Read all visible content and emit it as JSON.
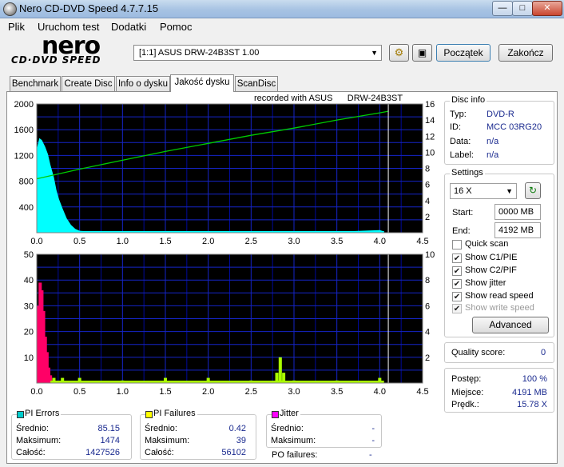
{
  "window": {
    "title": "Nero CD-DVD Speed 4.7.7.15"
  },
  "menu": [
    "Plik",
    "Uruchom test",
    "Dodatki",
    "Pomoc"
  ],
  "logo": {
    "main": "nero",
    "sub": "CD·DVD SPEED"
  },
  "toolbar": {
    "drive": "[1:1]   ASUS DRW-24B3ST 1.00",
    "start_label": "Początek",
    "end_label": "Zakończ"
  },
  "tabs": [
    "Benchmark",
    "Create Disc",
    "Info o dysku",
    "Jakość dysku",
    "ScanDisc"
  ],
  "active_tab": 3,
  "recorded_label": "recorded with ASUS      DRW-24B3ST",
  "chart_data": [
    {
      "type": "area",
      "title": "",
      "x_ticks": [
        "0.0",
        "0.5",
        "1.0",
        "1.5",
        "2.0",
        "2.5",
        "3.0",
        "3.5",
        "4.0",
        "4.5"
      ],
      "y_left_ticks": [
        "2000",
        "1600",
        "1200",
        "800",
        "400"
      ],
      "y_right_ticks": [
        "16",
        "14",
        "12",
        "10",
        "8",
        "6",
        "4",
        "2"
      ],
      "xlim": [
        0,
        4.5
      ],
      "ylim_left": [
        0,
        2000
      ],
      "ylim_right": [
        0,
        16
      ],
      "grid": true,
      "series": [
        {
          "x": [
            0.0,
            0.03,
            0.06,
            0.1,
            0.13,
            0.16,
            0.2,
            0.23,
            0.26,
            0.3,
            0.35,
            0.4,
            0.45,
            0.5,
            0.6,
            0.8,
            1.0,
            1.5,
            2.0,
            2.5,
            3.0,
            3.5,
            4.0,
            4.05
          ],
          "values": [
            1300,
            1470,
            1440,
            1330,
            1220,
            1050,
            860,
            660,
            520,
            380,
            220,
            120,
            60,
            30,
            20,
            15,
            15,
            14,
            14,
            15,
            15,
            16,
            40,
            20
          ]
        },
        {
          "x": [
            0,
            0.5,
            1.0,
            1.5,
            2.0,
            2.5,
            3.0,
            3.5,
            4.0,
            4.1
          ],
          "values": [
            6.7,
            7.9,
            9.0,
            10.1,
            11.1,
            12.1,
            13.0,
            14.0,
            14.9,
            15.1
          ],
          "axis": "right"
        }
      ],
      "colors": [
        "#00ffff",
        "#00cc00"
      ],
      "marker_x": 4.1
    },
    {
      "type": "bar",
      "title": "",
      "x_ticks": [
        "0.0",
        "0.5",
        "1.0",
        "1.5",
        "2.0",
        "2.5",
        "3.0",
        "3.5",
        "4.0",
        "4.5"
      ],
      "y_left_ticks": [
        "50",
        "40",
        "30",
        "20",
        "10"
      ],
      "y_right_ticks": [
        "10",
        "8",
        "6",
        "4",
        "2"
      ],
      "xlim": [
        0,
        4.5
      ],
      "ylim_left": [
        0,
        50
      ],
      "ylim_right": [
        0,
        10
      ],
      "grid": true,
      "series": [
        {
          "x": [
            0.02,
            0.04,
            0.06,
            0.08,
            0.1,
            0.12,
            0.14,
            0.16,
            0.2,
            0.3,
            0.5,
            1.0,
            1.5,
            2.0,
            2.5,
            2.8,
            2.84,
            2.88,
            3.0,
            3.5,
            4.0
          ],
          "values": [
            30,
            39,
            36,
            28,
            18,
            12,
            6,
            3,
            2,
            2,
            2,
            1,
            2,
            2,
            1,
            4,
            10,
            4,
            1,
            1,
            2
          ]
        }
      ],
      "colors": [
        "#ff0066",
        "#aaff00"
      ],
      "marker_x": 4.1
    }
  ],
  "disc_info": {
    "title": "Disc info",
    "rows": [
      {
        "label": "Typ:",
        "value": "DVD-R"
      },
      {
        "label": "ID:",
        "value": "MCC 03RG20"
      },
      {
        "label": "Data:",
        "value": "n/a"
      },
      {
        "label": "Label:",
        "value": "n/a"
      }
    ]
  },
  "settings": {
    "title": "Settings",
    "speed": "16 X",
    "start_label": "Start:",
    "start_value": "0000 MB",
    "end_label": "End:",
    "end_value": "4192 MB",
    "checks": [
      {
        "label": "Quick scan",
        "checked": false,
        "enabled": true
      },
      {
        "label": "Show C1/PIE",
        "checked": true,
        "enabled": true
      },
      {
        "label": "Show C2/PIF",
        "checked": true,
        "enabled": true
      },
      {
        "label": "Show jitter",
        "checked": true,
        "enabled": true
      },
      {
        "label": "Show read speed",
        "checked": true,
        "enabled": true
      },
      {
        "label": "Show write speed",
        "checked": true,
        "enabled": false
      }
    ],
    "advanced_label": "Advanced"
  },
  "quality": {
    "label": "Quality score:",
    "value": "0"
  },
  "progress": {
    "rows": [
      {
        "label": "Postęp:",
        "value": "100 %"
      },
      {
        "label": "Miejsce:",
        "value": "4191 MB"
      },
      {
        "label": "Prędk.:",
        "value": "15.78 X"
      }
    ]
  },
  "stats": {
    "pi_errors": {
      "title": "PI Errors",
      "color": "#00cccc",
      "rows": [
        {
          "label": "Średnio:",
          "value": "85.15"
        },
        {
          "label": "Maksimum:",
          "value": "1474"
        },
        {
          "label": "Całość:",
          "value": "1427526"
        }
      ]
    },
    "pi_failures": {
      "title": "PI Failures",
      "color": "#ffff00",
      "rows": [
        {
          "label": "Średnio:",
          "value": "0.42"
        },
        {
          "label": "Maksimum:",
          "value": "39"
        },
        {
          "label": "Całość:",
          "value": "56102"
        }
      ]
    },
    "jitter": {
      "title": "Jitter",
      "color": "#ff00ff",
      "rows": [
        {
          "label": "Średnio:",
          "value": "-"
        },
        {
          "label": "Maksimum:",
          "value": "-"
        }
      ]
    },
    "po_failures": {
      "label": "PO failures:",
      "value": "-"
    }
  }
}
